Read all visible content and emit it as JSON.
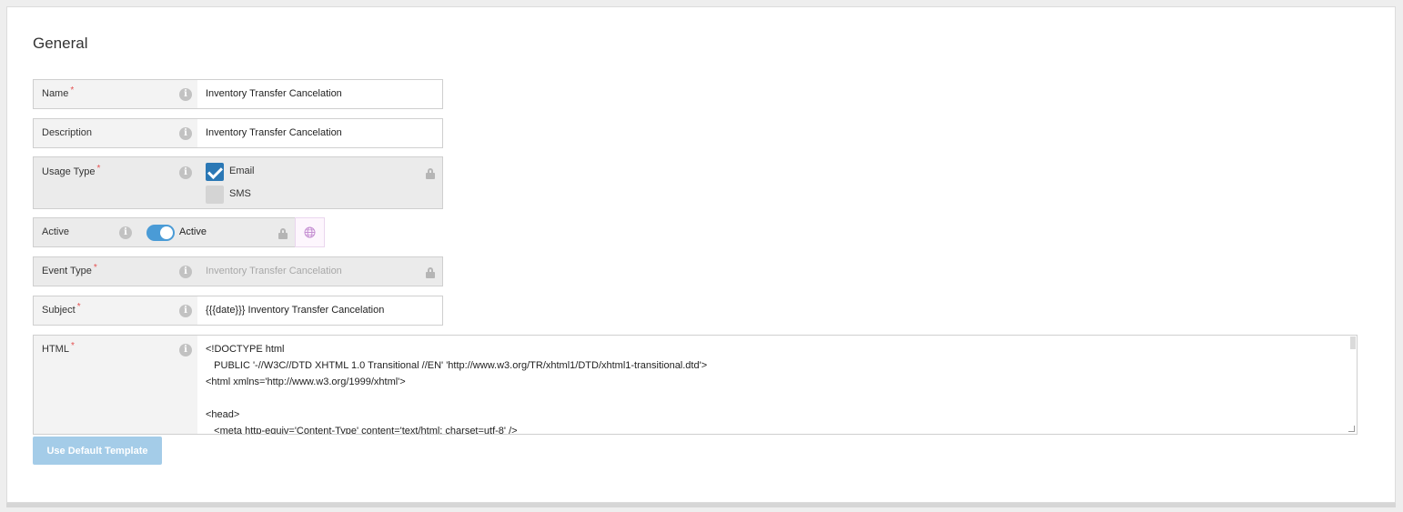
{
  "section": {
    "title": "General"
  },
  "fields": {
    "name": {
      "label": "Name",
      "value": "Inventory Transfer Cancelation"
    },
    "description": {
      "label": "Description",
      "value": "Inventory Transfer Cancelation"
    },
    "usage_type": {
      "label": "Usage Type",
      "options": [
        {
          "label": "Email",
          "checked": true
        },
        {
          "label": "SMS",
          "checked": false
        }
      ]
    },
    "active": {
      "label": "Active",
      "toggle_label": "Active",
      "on": true
    },
    "event_type": {
      "label": "Event Type",
      "value": "Inventory Transfer Cancelation"
    },
    "subject": {
      "label": "Subject",
      "value": "{{{date}}} Inventory Transfer Cancelation"
    },
    "html": {
      "label": "HTML",
      "lines": [
        "<!DOCTYPE html",
        "   PUBLIC '-//W3C//DTD XHTML 1.0 Transitional //EN' 'http://www.w3.org/TR/xhtml1/DTD/xhtml1-transitional.dtd'>",
        "<html xmlns='http://www.w3.org/1999/xhtml'>",
        "",
        "<head>",
        "   <meta http-equiv='Content-Type' content='text/html; charset=utf-8' />"
      ]
    }
  },
  "required_marker": "*",
  "buttons": {
    "use_default_template": "Use Default Template"
  },
  "colors": {
    "accent": "#2b78b5",
    "toggle": "#4a9bd6",
    "required": "#e55353",
    "button": "#a4cce8"
  },
  "icons": {
    "info": "info-icon",
    "lock": "lock-icon",
    "globe": "globe-icon"
  }
}
